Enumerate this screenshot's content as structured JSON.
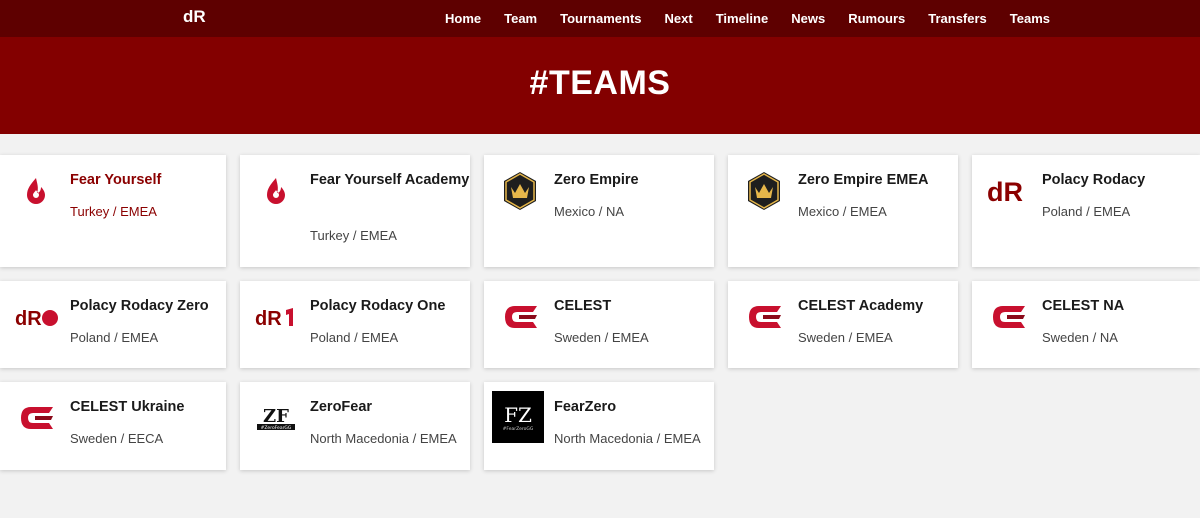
{
  "header": {
    "logo_alt": "dR",
    "nav": [
      "Home",
      "Team",
      "Tournaments",
      "Next",
      "Timeline",
      "News",
      "Rumours",
      "Transfers",
      "Teams"
    ]
  },
  "hero": {
    "title": "#TEAMS"
  },
  "colors": {
    "topbar": "#5e0000",
    "hero": "#830000",
    "accent": "#8b0000",
    "celest": "#c8102e",
    "zero_empire_gold": "#e5b64a"
  },
  "teams": [
    {
      "name": "Fear Yourself",
      "region": "Turkey / EMEA",
      "icon": "flame-icon"
    },
    {
      "name": "Fear Yourself Academy",
      "region": "Turkey / EMEA",
      "icon": "flame-icon"
    },
    {
      "name": "Zero Empire",
      "region": "Mexico / NA",
      "icon": "crown-shield-icon"
    },
    {
      "name": "Zero Empire EMEA",
      "region": "Mexico / EMEA",
      "icon": "crown-shield-icon"
    },
    {
      "name": "Polacy Rodacy",
      "region": "Poland / EMEA",
      "icon": "dr-logo-icon"
    },
    {
      "name": "Polacy Rodacy Zero",
      "region": "Poland / EMEA",
      "icon": "dr-zero-logo-icon"
    },
    {
      "name": "Polacy Rodacy One",
      "region": "Poland / EMEA",
      "icon": "dr-one-logo-icon"
    },
    {
      "name": "CELEST",
      "region": "Sweden / EMEA",
      "icon": "celest-c-icon"
    },
    {
      "name": "CELEST Academy",
      "region": "Sweden / EMEA",
      "icon": "celest-c-icon"
    },
    {
      "name": "CELEST NA",
      "region": "Sweden / NA",
      "icon": "celest-c-icon"
    },
    {
      "name": "CELEST Ukraine",
      "region": "Sweden / EECA",
      "icon": "celest-c-icon"
    },
    {
      "name": "ZeroFear",
      "region": "North Macedonia / EMEA",
      "icon": "zf-logo-icon",
      "logo_text": "ZF",
      "logo_sub": "#ZeroFearGG"
    },
    {
      "name": "FearZero",
      "region": "North Macedonia / EMEA",
      "icon": "fz-logo-icon",
      "logo_text": "FZ",
      "logo_sub": "#FearZeroGG"
    }
  ]
}
